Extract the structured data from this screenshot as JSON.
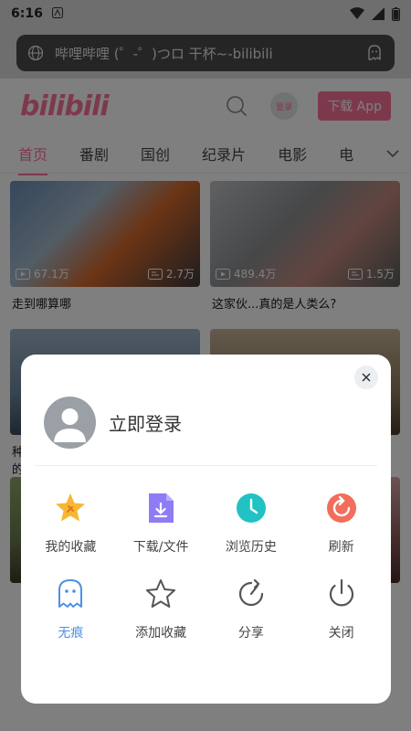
{
  "status": {
    "time": "6:16"
  },
  "urlbar": {
    "text": "哔哩哔哩 (゜-゜)つロ 干杯~-bilibili"
  },
  "header": {
    "logo": "bilibili",
    "login_chip": "登录",
    "download_btn": "下载 App"
  },
  "tabs": [
    {
      "label": "首页"
    },
    {
      "label": "番剧"
    },
    {
      "label": "国创"
    },
    {
      "label": "纪录片"
    },
    {
      "label": "电影"
    },
    {
      "label": "电"
    }
  ],
  "feed": [
    {
      "views": "67.1万",
      "comments": "2.7万",
      "title": "走到哪算哪"
    },
    {
      "views": "489.4万",
      "comments": "1.5万",
      "title": "这家伙...真的是人类么?"
    }
  ],
  "partial_text": {
    "left1": "种",
    "left2": "的"
  },
  "modal": {
    "profile_name": "立即登录",
    "items": [
      {
        "label": "我的收藏",
        "icon": "star-favorites-icon",
        "color": "#f5a623"
      },
      {
        "label": "下载/文件",
        "icon": "download-file-icon",
        "color": "#7b6cf2"
      },
      {
        "label": "浏览历史",
        "icon": "history-clock-icon",
        "color": "#22c1c3"
      },
      {
        "label": "刷新",
        "icon": "refresh-icon",
        "color": "#f26d5b"
      },
      {
        "label": "无痕",
        "icon": "incognito-ghost-icon",
        "color": "#4d8fe6"
      },
      {
        "label": "添加收藏",
        "icon": "star-outline-icon",
        "color": "#555555"
      },
      {
        "label": "分享",
        "icon": "share-icon",
        "color": "#555555"
      },
      {
        "label": "关闭",
        "icon": "power-icon",
        "color": "#555555"
      }
    ]
  },
  "colors": {
    "brand": "#fb7299",
    "accent_blue": "#4d8fe6"
  }
}
